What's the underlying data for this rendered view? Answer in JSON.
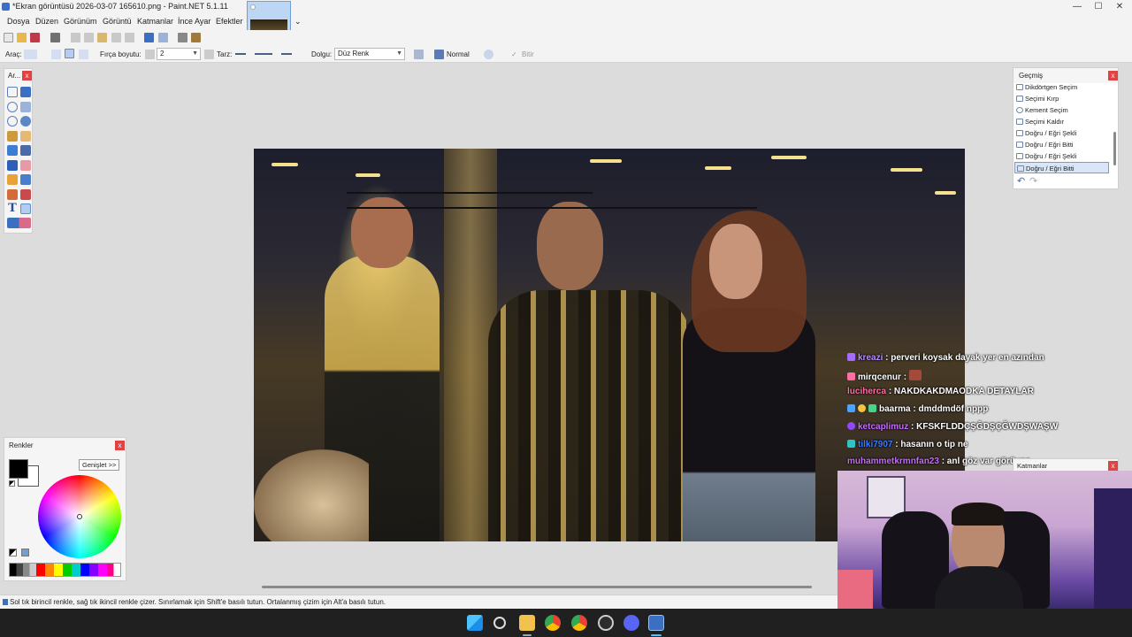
{
  "window": {
    "title": "*Ekran görüntüsü 2026-03-07 165610.png - Paint.NET 5.1.11",
    "minimize": "—",
    "maximize": "☐",
    "close": "✕"
  },
  "menu": {
    "items": [
      "Dosya",
      "Düzen",
      "Görünüm",
      "Görüntü",
      "Katmanlar",
      "İnce Ayar",
      "Efektler"
    ],
    "tab_dropdown": "⌄"
  },
  "toolbar2": {
    "tool_label": "Araç:",
    "brush_label": "Fırça boyutu:",
    "brush_value": "2",
    "style_label": "Tarz:",
    "fill_label": "Dolgu:",
    "fill_value": "Düz Renk",
    "blend_value": "Normal",
    "finish_label": "Bitir"
  },
  "tools_panel": {
    "title": "Ar...",
    "close": "x"
  },
  "history": {
    "title": "Geçmiş",
    "close": "x",
    "items": [
      {
        "label": "Dikdörtgen Seçim",
        "selected": false
      },
      {
        "label": "Seçimi Kırp",
        "selected": false
      },
      {
        "label": "Kement Seçim",
        "selected": false
      },
      {
        "label": "Seçimi Kaldır",
        "selected": false
      },
      {
        "label": "Doğru / Eğri Şekli",
        "selected": false
      },
      {
        "label": "Doğru / Eğri Bitti",
        "selected": false
      },
      {
        "label": "Doğru / Eğri Şekli",
        "selected": false
      },
      {
        "label": "Doğru / Eğri Bitti",
        "selected": true
      }
    ],
    "undo": "↶",
    "redo": "↷"
  },
  "layers": {
    "title": "Katmanlar",
    "close": "x"
  },
  "colors": {
    "title": "Renkler",
    "close": "x",
    "expand": "Genişlet >>",
    "primary": "#000000",
    "secondary": "#ffffff"
  },
  "status": {
    "text": "Sol tık birincil renkle, sağ tık ikincil renkle çizer. Sınırlamak için Shift'e basılı tutun. Ortalanmış çizim için Alt'a basılı tutun."
  },
  "chat": [
    {
      "user": "kreazi",
      "message": ": perveri koysak dayak yer en azından",
      "user_color": "#b58cff"
    },
    {
      "user": "mirqcenur",
      "message": ":",
      "user_color": "#ffffff"
    },
    {
      "user": "luciherса",
      "message": ": NAKDKAKDMAODKA DETAYLAR",
      "user_color": "#ff6fa3"
    },
    {
      "user": "baarma",
      "message": ": dmddmdöf nppp",
      "user_color": "#ffffff"
    },
    {
      "user": "ketcaplimuz",
      "message": ": KFSKFLDDÇŞĞDŞÇĞWDŞWAŞW",
      "user_color": "#c66bff"
    },
    {
      "user": "tilki7907",
      "message": ": hasanın o tip ne",
      "user_color": "#3a7bff"
    },
    {
      "user": "muhammetkrmnfan23",
      "message": ": anl göz var görüyoz",
      "user_color": "#c66bff"
    }
  ],
  "accent_colors": {
    "selection": "#d8e6f8",
    "close_button": "#e04343",
    "taskbar": "#202020"
  }
}
